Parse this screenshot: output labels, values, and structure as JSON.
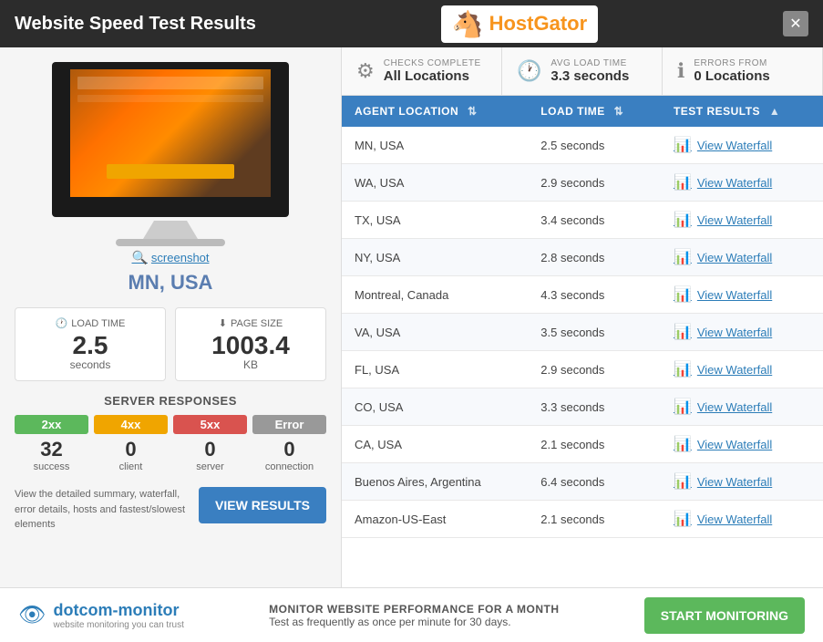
{
  "titleBar": {
    "title": "Website Speed Test Results",
    "close_label": "✕"
  },
  "logo": {
    "text": "HostGator",
    "seahorse": "🐴"
  },
  "statsBar": {
    "checks": {
      "label": "CHECKS COMPLETE",
      "value": "All Locations",
      "icon": "⚙"
    },
    "avgLoad": {
      "label": "AVG LOAD TIME",
      "value": "3.3 seconds",
      "icon": "🕐"
    },
    "errors": {
      "label": "ERRORS FROM",
      "value": "0 Locations",
      "icon": "ℹ"
    }
  },
  "tableHeaders": {
    "location": "AGENT LOCATION",
    "loadTime": "LOAD TIME",
    "testResults": "TEST RESULTS"
  },
  "tableRows": [
    {
      "location": "MN, USA",
      "loadTime": "2.5 seconds"
    },
    {
      "location": "WA, USA",
      "loadTime": "2.9 seconds"
    },
    {
      "location": "TX, USA",
      "loadTime": "3.4 seconds"
    },
    {
      "location": "NY, USA",
      "loadTime": "2.8 seconds"
    },
    {
      "location": "Montreal, Canada",
      "loadTime": "4.3 seconds"
    },
    {
      "location": "VA, USA",
      "loadTime": "3.5 seconds"
    },
    {
      "location": "FL, USA",
      "loadTime": "2.9 seconds"
    },
    {
      "location": "CO, USA",
      "loadTime": "3.3 seconds"
    },
    {
      "location": "CA, USA",
      "loadTime": "2.1 seconds"
    },
    {
      "location": "Buenos Aires, Argentina",
      "loadTime": "6.4 seconds"
    },
    {
      "location": "Amazon-US-East",
      "loadTime": "2.1 seconds"
    }
  ],
  "viewWaterfall": "View Waterfall",
  "leftPanel": {
    "locationName": "MN, USA",
    "screenshotLink": "screenshot",
    "loadTime": {
      "label": "LOAD TIME",
      "value": "2.5",
      "unit": "seconds"
    },
    "pageSize": {
      "label": "PAGE SIZE",
      "value": "1003.4",
      "unit": "KB"
    },
    "serverResponsesTitle": "SERVER RESPONSES",
    "responses": {
      "success": {
        "badge": "2xx",
        "count": "32",
        "label": "success"
      },
      "client": {
        "badge": "4xx",
        "count": "0",
        "label": "client"
      },
      "server": {
        "badge": "5xx",
        "count": "0",
        "label": "server"
      },
      "error": {
        "badge": "Error",
        "count": "0",
        "label": "connection"
      }
    },
    "description": "View the detailed summary, waterfall, error details, hosts and fastest/slowest elements",
    "viewResultsBtn": "VIEW RESULTS"
  },
  "footer": {
    "brandName": "dotcom-monitor",
    "tagline": "website monitoring you can trust",
    "monitorText": "MONITOR WEBSITE PERFORMANCE FOR A MONTH",
    "monitorSubtext": "Test as frequently as once per minute for 30 days.",
    "startBtn": "START MONITORING"
  }
}
